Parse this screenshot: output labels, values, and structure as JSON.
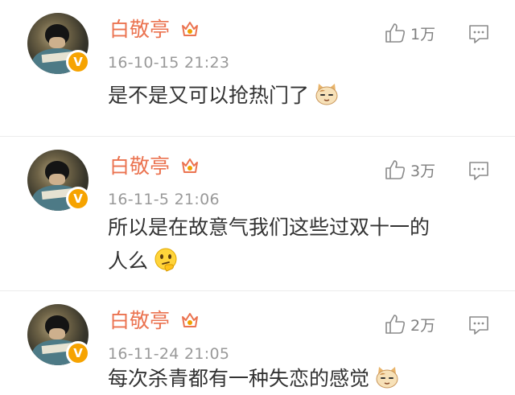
{
  "comments": [
    {
      "author": "白敬亭",
      "time": "16-10-15 21:23",
      "likes": "1万",
      "text_lines": [
        "是不是又可以抢热门了"
      ],
      "emoji": "cat-face-emoji"
    },
    {
      "author": "白敬亭",
      "time": "16-11-5 21:06",
      "likes": "3万",
      "text_lines": [
        "所以是在故意气我们这些过双十一的",
        "人么"
      ],
      "emoji": "thinking-face-emoji"
    },
    {
      "author": "白敬亭",
      "time": "16-11-24 21:05",
      "likes": "2万",
      "text_lines": [
        "每次杀青都有一种失恋的感觉"
      ],
      "emoji": "cat-face-emoji"
    }
  ],
  "verified_badge": "V",
  "icons": {
    "like": "thumbs-up-icon",
    "reply": "comment-icon",
    "member": "member-crown-icon",
    "verified": "verified-badge-icon"
  },
  "colors": {
    "author_name": "#eb7350",
    "timestamp": "#999999",
    "body_text": "#333333",
    "verified_badge": "#f6a300",
    "icon_gray": "#8a8a8a"
  }
}
